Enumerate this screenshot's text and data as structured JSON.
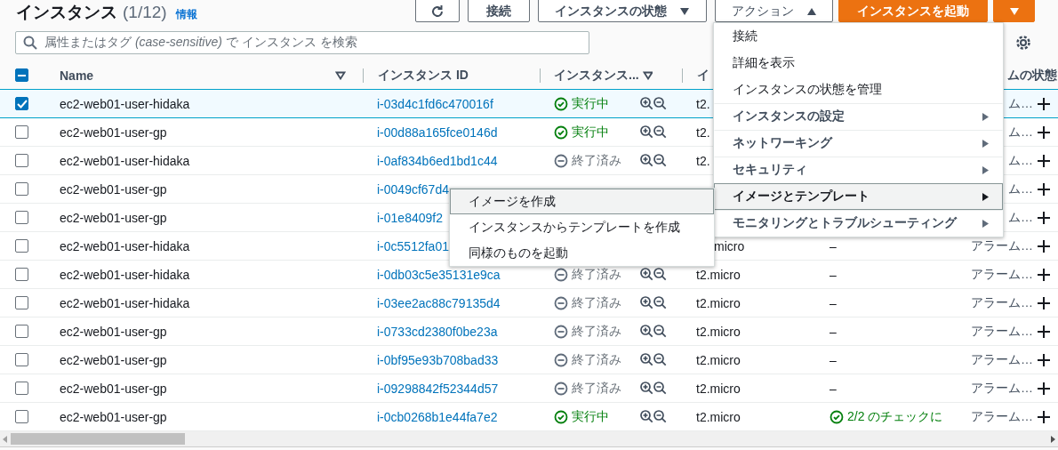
{
  "header": {
    "title": "インスタンス",
    "count": "(1/12)",
    "info_link": "情報"
  },
  "toolbar": [
    {
      "kind": "refresh"
    },
    {
      "kind": "text",
      "label": "接続"
    },
    {
      "kind": "dropdown",
      "label": "インスタンスの状態",
      "expanded": false
    },
    {
      "kind": "dropdown",
      "label": "アクション",
      "expanded": true
    },
    {
      "kind": "primary",
      "label": "インスタンスを起動"
    },
    {
      "kind": "primary-caret"
    }
  ],
  "search": {
    "placeholder": "属性またはタグ *(case-sensitive)* で インスタンス を検索"
  },
  "table": {
    "select_all": {
      "indeterminate": true
    },
    "columns": {
      "name": {
        "label": "Name",
        "filter": true
      },
      "instance_id": {
        "label": "インスタンス ID"
      },
      "state": {
        "label": "インスタンス...",
        "filter": true
      },
      "type": {
        "label": "イ"
      },
      "alarm": {
        "label": "ムの状態"
      }
    },
    "rows": [
      {
        "selected": true,
        "name": "ec2-web01-user-hidaka",
        "instance_id": "i-03d4c1fd6c470016f",
        "state": {
          "kind": "running",
          "label": "実行中"
        },
        "type": "t2.",
        "alarm": "ム…"
      },
      {
        "selected": false,
        "name": "ec2-web01-user-gp",
        "instance_id": "i-00d88a165fce0146d",
        "state": {
          "kind": "running",
          "label": "実行中"
        },
        "type": "t2.",
        "alarm": "ム…"
      },
      {
        "selected": false,
        "name": "ec2-web01-user-hidaka",
        "instance_id": "i-0af834b6ed1bd1c44",
        "state": {
          "kind": "terminated",
          "label": "終了済み"
        },
        "type": "t2.",
        "alarm": "ム…"
      },
      {
        "selected": false,
        "name": "ec2-web01-user-gp",
        "instance_id": "i-0049cf67d4",
        "alarm": "ム…"
      },
      {
        "selected": false,
        "name": "ec2-web01-user-gp",
        "instance_id": "i-01e8409f2",
        "alarm": "ム…"
      },
      {
        "selected": false,
        "name": "ec2-web01-user-hidaka",
        "instance_id": "i-0c5512fa01",
        "type": "micro",
        "status_check": {
          "kind": "none",
          "label": "–"
        },
        "alarm": "アラーム…"
      },
      {
        "selected": false,
        "name": "ec2-web01-user-hidaka",
        "instance_id": "i-0db03c5e35131e9ca",
        "state": {
          "kind": "terminated",
          "label": "終了済み"
        },
        "type": "t2.micro",
        "status_check": {
          "kind": "none",
          "label": "–"
        },
        "alarm": "アラーム…"
      },
      {
        "selected": false,
        "name": "ec2-web01-user-hidaka",
        "instance_id": "i-03ee2ac88c79135d4",
        "state": {
          "kind": "terminated",
          "label": "終了済み"
        },
        "type": "t2.micro",
        "status_check": {
          "kind": "none",
          "label": "–"
        },
        "alarm": "アラーム…"
      },
      {
        "selected": false,
        "name": "ec2-web01-user-gp",
        "instance_id": "i-0733cd2380f0be23a",
        "state": {
          "kind": "terminated",
          "label": "終了済み"
        },
        "type": "t2.micro",
        "status_check": {
          "kind": "none",
          "label": "–"
        },
        "alarm": "アラーム…"
      },
      {
        "selected": false,
        "name": "ec2-web01-user-gp",
        "instance_id": "i-0bf95e93b708bad33",
        "state": {
          "kind": "terminated",
          "label": "終了済み"
        },
        "type": "t2.micro",
        "status_check": {
          "kind": "none",
          "label": "–"
        },
        "alarm": "アラーム…"
      },
      {
        "selected": false,
        "name": "ec2-web01-user-gp",
        "instance_id": "i-09298842f52344d57",
        "state": {
          "kind": "terminated",
          "label": "終了済み"
        },
        "type": "t2.micro",
        "status_check": {
          "kind": "none",
          "label": "–"
        },
        "alarm": "アラーム…"
      },
      {
        "selected": false,
        "name": "ec2-web01-user-gp",
        "instance_id": "i-0cb0268b1e44fa7e2",
        "state": {
          "kind": "running",
          "label": "実行中"
        },
        "type": "t2.micro",
        "status_check": {
          "kind": "passed",
          "label": "2/2 のチェックに"
        },
        "alarm": "アラーム…"
      }
    ]
  },
  "actions_menu": {
    "items": [
      {
        "label": "接続",
        "submenu": false,
        "selected": false
      },
      {
        "label": "詳細を表示",
        "submenu": false,
        "selected": false
      },
      {
        "label": "インスタンスの状態を管理",
        "submenu": false,
        "selected": false
      },
      {
        "label": "インスタンスの設定",
        "submenu": true,
        "selected": false
      },
      {
        "label": "ネットワーキング",
        "submenu": true,
        "selected": false
      },
      {
        "label": "セキュリティ",
        "submenu": true,
        "selected": false
      },
      {
        "label": "イメージとテンプレート",
        "submenu": true,
        "selected": true
      },
      {
        "label": "モニタリングとトラブルシューティング",
        "submenu": true,
        "selected": false
      }
    ]
  },
  "submenu": {
    "items": [
      {
        "label": "イメージを作成",
        "selected": true
      },
      {
        "label": "インスタンスからテンプレートを作成",
        "selected": false
      },
      {
        "label": "同様のものを起動",
        "selected": false
      }
    ]
  }
}
